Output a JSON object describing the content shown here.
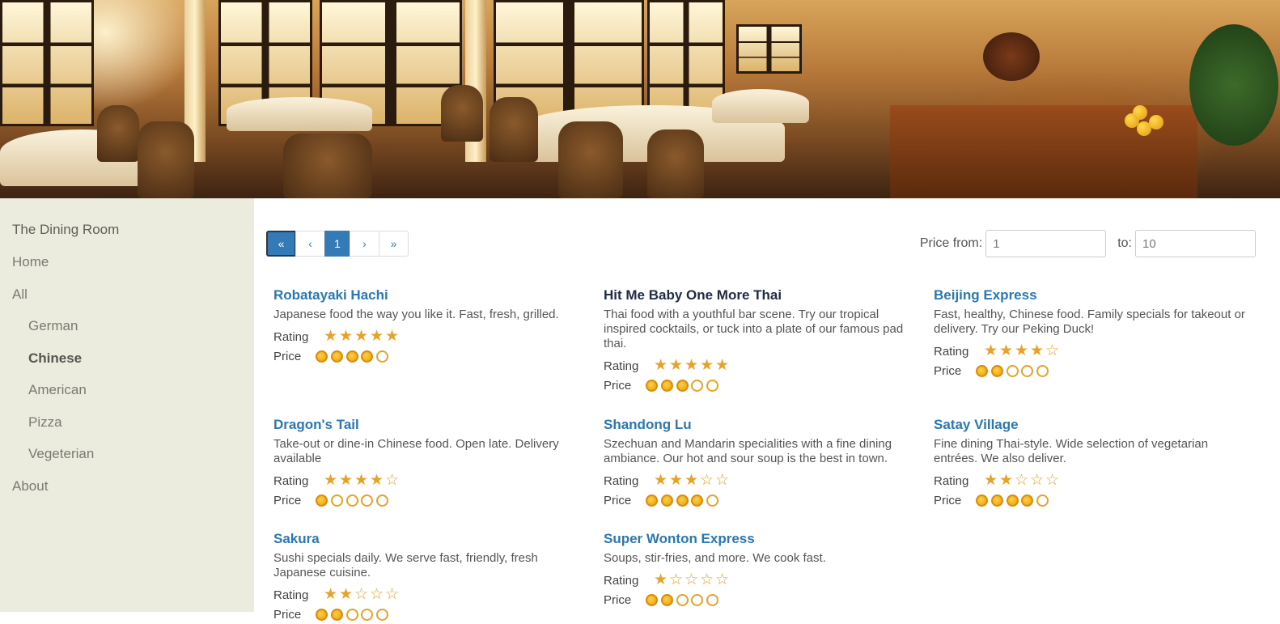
{
  "sidebar": {
    "brand": "The Dining Room",
    "items": [
      {
        "label": "Home",
        "sub": false,
        "active": false
      },
      {
        "label": "All",
        "sub": false,
        "active": false
      },
      {
        "label": "German",
        "sub": true,
        "active": false
      },
      {
        "label": "Chinese",
        "sub": true,
        "active": true
      },
      {
        "label": "American",
        "sub": true,
        "active": false
      },
      {
        "label": "Pizza",
        "sub": true,
        "active": false
      },
      {
        "label": "Vegeterian",
        "sub": true,
        "active": false
      },
      {
        "label": "About",
        "sub": false,
        "active": false
      }
    ]
  },
  "pager": {
    "first": "«",
    "prev": "‹",
    "current": "1",
    "next": "›",
    "last": "»"
  },
  "filter": {
    "from_label": "Price from:",
    "from_value": "1",
    "to_label": "to:",
    "to_value": "10"
  },
  "labels": {
    "rating": "Rating",
    "price": "Price"
  },
  "restaurants": [
    {
      "name": "Robatayaki Hachi",
      "desc": "Japanese food the way you like it. Fast, fresh, grilled.",
      "rating": 5,
      "price": 4
    },
    {
      "name": "Hit Me Baby One More Thai",
      "desc": "Thai food with a youthful bar scene. Try our tropical inspired cocktails, or tuck into a plate of our famous pad thai.",
      "rating": 5,
      "price": 3
    },
    {
      "name": "Beijing Express",
      "desc": "Fast, healthy, Chinese food. Family specials for takeout or delivery. Try our Peking Duck!",
      "rating": 4,
      "price": 2
    },
    {
      "name": "Dragon's Tail",
      "desc": "Take-out or dine-in Chinese food. Open late. Delivery available",
      "rating": 4,
      "price": 1
    },
    {
      "name": "Shandong Lu",
      "desc": "Szechuan and Mandarin specialities with a fine dining ambiance. Our hot and sour soup is the best in town.",
      "rating": 3,
      "price": 4
    },
    {
      "name": "Satay Village",
      "desc": "Fine dining Thai-style. Wide selection of vegetarian entrées. We also deliver.",
      "rating": 2,
      "price": 4
    },
    {
      "name": "Sakura",
      "desc": "Sushi specials daily. We serve fast, friendly, fresh Japanese cuisine.",
      "rating": 2,
      "price": 2
    },
    {
      "name": "Super Wonton Express",
      "desc": "Soups, stir-fries, and more. We cook fast.",
      "rating": 1,
      "price": 2
    }
  ],
  "colors": {
    "accent": "#337ab7",
    "link": "#2a78b3",
    "star": "#e8a229",
    "sidebar_bg": "#ebecdd"
  }
}
